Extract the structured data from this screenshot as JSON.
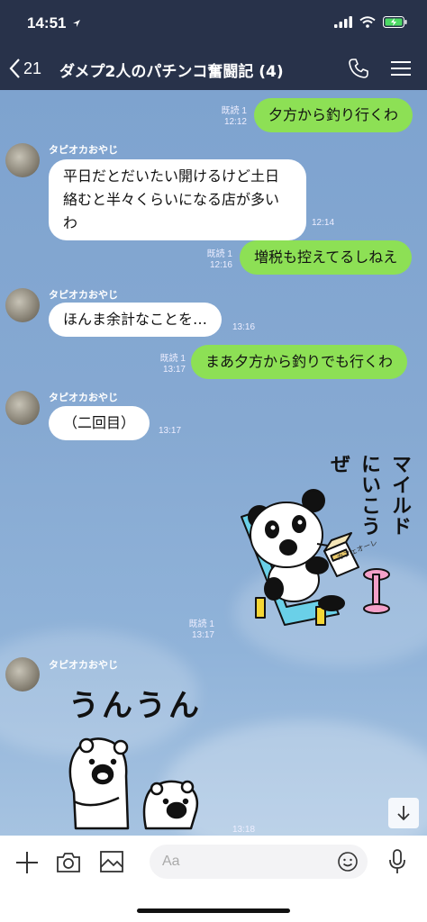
{
  "status": {
    "time": "14:51"
  },
  "header": {
    "back_count": "21",
    "title": "ダメプ2人のパチンコ奮闘記 (4)"
  },
  "messages": {
    "m1": {
      "text": "夕方から釣り行くわ",
      "read": "既読 1",
      "time": "12:12"
    },
    "m2": {
      "sender": "タピオカおやじ",
      "lines": [
        "平日だとだいたい開けるけど土日",
        "絡むと半々くらいになる店が多い",
        "わ"
      ],
      "time": "12:14"
    },
    "m3": {
      "text": "増税も控えてるしねえ",
      "read": "既読 1",
      "time": "12:16"
    },
    "m4": {
      "sender": "タピオカおやじ",
      "text": "ほんま余計なことを…",
      "time": "13:16"
    },
    "m5": {
      "text": "まあ夕方から釣りでも行くわ",
      "read": "既読 1",
      "time": "13:17"
    },
    "m6": {
      "sender": "タピオカおやじ",
      "text": "（二回目）",
      "time": "13:17"
    },
    "m7": {
      "sticker_text": "マイルドにいこうぜ",
      "carton_text": "カフェオーレ",
      "read": "既読 1",
      "time": "13:17"
    },
    "m8": {
      "sender": "タピオカおやじ",
      "sticker_text": "うんうん",
      "time": "13:18"
    }
  },
  "input": {
    "placeholder": "Aa"
  }
}
